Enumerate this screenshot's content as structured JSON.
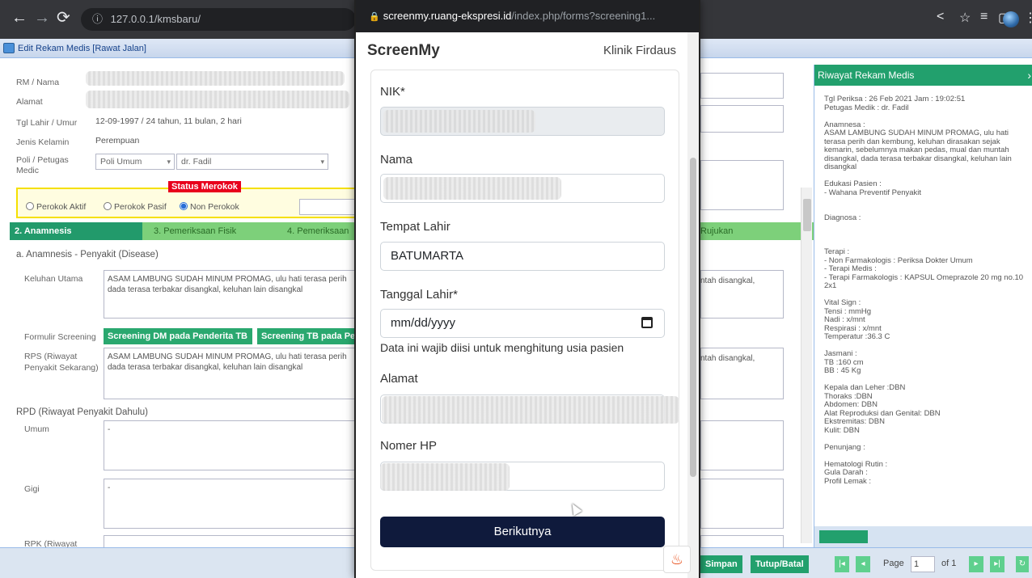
{
  "browser": {
    "url": "127.0.0.1/kmsbaru/",
    "info_icon": "ⓘ"
  },
  "app": {
    "window_title": "Edit Rekam Medis [Rawat Jalan]"
  },
  "patient_form": {
    "rm_label": "RM / Nama",
    "alamat_label": "Alamat",
    "tgl_label": "Tgl Lahir / Umur",
    "tgl_value": "12-09-1997 / 24 tahun, 11 bulan, 2 hari",
    "jk_label": "Jenis Kelamin",
    "jk_value": "Perempuan",
    "poli_label": "Poli / Petugas Medic",
    "poli_value": "Poli Umum",
    "petugas_value": "dr. Fadil",
    "smoke_title": "Status Merokok",
    "smoke_options": [
      "Perokok Aktif",
      "Perokok Pasif",
      "Non Perokok"
    ],
    "smoke_selected": "Non Perokok"
  },
  "tabs": [
    {
      "label": "2. Anamnesis"
    },
    {
      "label": "3. Pemeriksaan Fisik"
    },
    {
      "label": "4. Pemeriksaan"
    },
    {
      "label": "Rujukan"
    }
  ],
  "anamnesis": {
    "section_title": "a. Anamnesis - Penyakit (Disease)",
    "keluhan_label": "Keluhan Utama",
    "keluhan_text": "ASAM LAMBUNG SUDAH MINUM PROMAG, ulu hati terasa perih dada terasa terbakar disangkal, keluhan lain disangkal",
    "keluhan_tail": "ntah disangkal,",
    "screening_label": "Formulir Screening",
    "screening_btn1": "Screening DM pada Penderita TB",
    "screening_btn2": "Screening TB pada Pe",
    "rps_label": "RPS (Riwayat Penyakit Sekarang)",
    "rps_text": "ASAM LAMBUNG SUDAH MINUM PROMAG, ulu hati terasa perih dada terasa terbakar disangkal, keluhan lain disangkal",
    "rps_tail": "ntah disangkal,",
    "rpd_title": "RPD (Riwayat Penyakit Dahulu)",
    "umum_label": "Umum",
    "umum_value": "-",
    "gigi_label": "Gigi",
    "gigi_value": "-",
    "rpk_label": "RPK (Riwayat"
  },
  "history_panel": {
    "title": "Riwayat Rekam Medis",
    "close_icon": "›",
    "body": "Tgl Periksa : 26 Feb 2021    Jam : 19:02:51\nPetugas Medik : dr. Fadil\n\nAnamnesa :\nASAM LAMBUNG SUDAH MINUM PROMAG, ulu hati terasa perih dan kembung, keluhan dirasakan sejak kemarin, sebelumnya makan pedas, mual dan muntah disangkal, dada terasa terbakar disangkal, keluhan lain disangkal\n\nEdukasi Pasien :\n- Wahana Preventif Penyakit\n\n\nDiagnosa :\n\n\n\nTerapi :\n- Non Farmakologis : Periksa Dokter Umum\n- Terapi Medis :\n- Terapi Farmakologis : KAPSUL Omeprazole 20 mg no.10 2x1\n\nVital Sign :\nTensi : mmHg\nNadi : x/mnt\nRespirasi : x/mnt\nTemperatur :36.3 C\n\nJasmani :\nTB :160 cm\nBB : 45 Kg\n\nKepala dan Leher :DBN\nThoraks :DBN\nAbdomen: DBN\nAlat Reproduksi dan Genital: DBN\nEkstremitas: DBN\nKulit: DBN\n\nPenunjang :\n\nHematologi Rutin :\nGula Darah :\nProfil Lemak :"
  },
  "bottom_bar": {
    "simpan": "Simpan",
    "tutup": "Tutup/Batal",
    "page_label": "Page",
    "page_value": "1",
    "of_label": "of 1"
  },
  "popup": {
    "url_host": "screenmy.ruang-ekspresi.id",
    "url_path": "/index.php/forms?screening1...",
    "brand": "ScreenMy",
    "clinic": "Klinik Firdaus",
    "nik_label": "NIK*",
    "nama_label": "Nama",
    "tempat_label": "Tempat Lahir",
    "tempat_value": "BATUMARTA",
    "tanggal_label": "Tanggal Lahir*",
    "tanggal_placeholder": "mm/dd/yyyy",
    "tanggal_hint": "Data ini wajib diisi untuk menghitung usia pasien",
    "alamat_label": "Alamat",
    "hp_label": "Nomer HP",
    "next_button": "Berikutnya"
  }
}
